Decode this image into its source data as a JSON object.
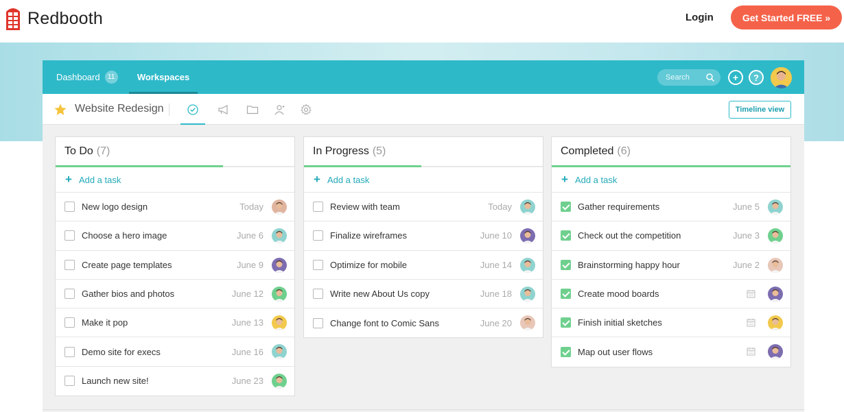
{
  "site": {
    "brand": "Redbooth",
    "login_label": "Login",
    "cta_label": "Get Started FREE »",
    "cta_color": "#f5624a"
  },
  "app": {
    "accent_color": "#2eb9c9",
    "nav": {
      "dashboard_label": "Dashboard",
      "dashboard_badge": "11",
      "workspaces_label": "Workspaces"
    },
    "search": {
      "placeholder": "Search"
    },
    "actions": {
      "add_icon": "plus-circle-icon",
      "help_label": "?"
    },
    "project": {
      "title": "Website Redesign",
      "tabs": [
        "tasks-check-icon",
        "megaphone-icon",
        "folder-icon",
        "people-icon",
        "settings-gear-icon"
      ],
      "timeline_label": "Timeline view"
    }
  },
  "columns": [
    {
      "title": "To Do",
      "count": "(7)",
      "progress": 0.7,
      "add_task_label": "Add a task",
      "tasks": [
        {
          "name": "New logo design",
          "date": "Today",
          "done": false,
          "avatar": "#e0b5a0"
        },
        {
          "name": "Choose a hero image",
          "date": "June 6",
          "done": false,
          "avatar": "#8fd3cf"
        },
        {
          "name": "Create page templates",
          "date": "June 9",
          "done": false,
          "avatar": "#7d6db0"
        },
        {
          "name": "Gather bios and photos",
          "date": "June 12",
          "done": false,
          "avatar": "#6fd08e"
        },
        {
          "name": "Make it pop",
          "date": "June 13",
          "done": false,
          "avatar": "#f2c94c"
        },
        {
          "name": "Demo site for execs",
          "date": "June 16",
          "done": false,
          "avatar": "#8fd3cf"
        },
        {
          "name": "Launch new site!",
          "date": "June 23",
          "done": false,
          "avatar": "#6fd08e"
        }
      ]
    },
    {
      "title": "In Progress",
      "count": "(5)",
      "progress": 0.49,
      "add_task_label": "Add a task",
      "tasks": [
        {
          "name": "Review with team",
          "date": "Today",
          "done": false,
          "avatar": "#8fd3cf"
        },
        {
          "name": "Finalize wireframes",
          "date": "June 10",
          "done": false,
          "avatar": "#7d6db0"
        },
        {
          "name": "Optimize for mobile",
          "date": "June 14",
          "done": false,
          "avatar": "#8fd3cf"
        },
        {
          "name": "Write new About Us copy",
          "date": "June 18",
          "done": false,
          "avatar": "#8fd3cf"
        },
        {
          "name": "Change font to Comic Sans",
          "date": "June 20",
          "done": false,
          "avatar": "#e8c7b8"
        }
      ]
    },
    {
      "title": "Completed",
      "count": "(6)",
      "progress": 1.0,
      "add_task_label": "Add a task",
      "tasks": [
        {
          "name": "Gather requirements",
          "date": "June 5",
          "done": true,
          "avatar": "#8fd3cf"
        },
        {
          "name": "Check out the competition",
          "date": "June 3",
          "done": true,
          "avatar": "#6fd08e"
        },
        {
          "name": "Brainstorming happy hour",
          "date": "June 2",
          "done": true,
          "avatar": "#e8c7b8"
        },
        {
          "name": "Create mood boards",
          "date": "",
          "done": true,
          "avatar": "#7d6db0"
        },
        {
          "name": "Finish initial sketches",
          "date": "",
          "done": true,
          "avatar": "#f2c94c"
        },
        {
          "name": "Map out user flows",
          "date": "",
          "done": true,
          "avatar": "#7d6db0"
        }
      ]
    }
  ]
}
